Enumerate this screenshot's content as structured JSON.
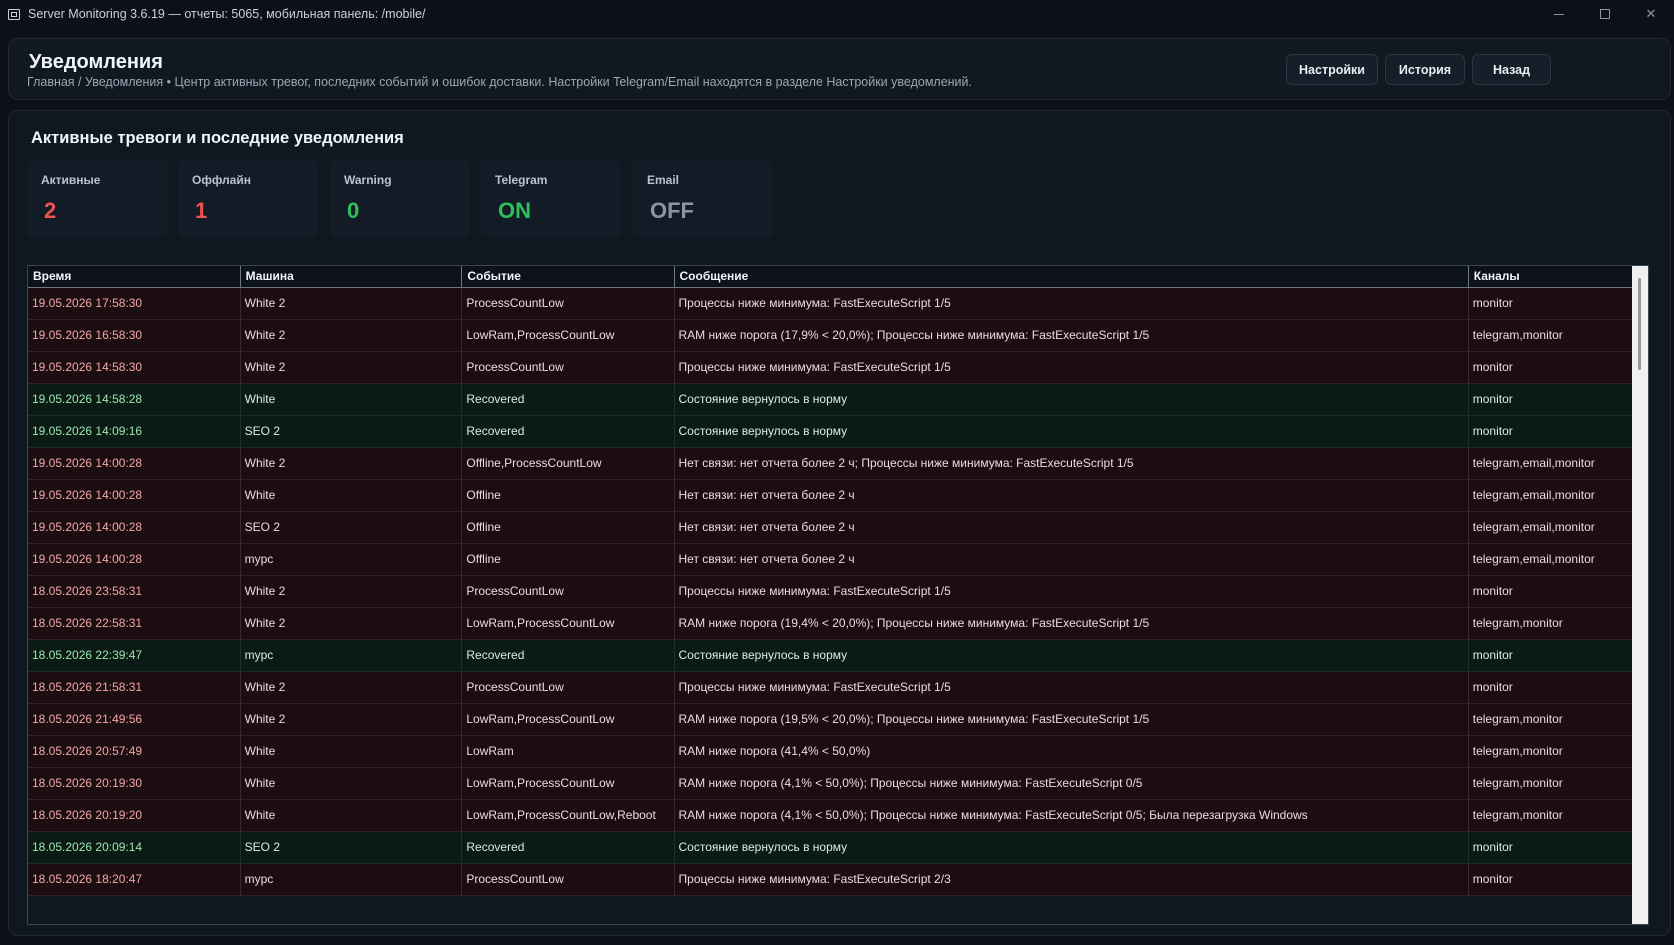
{
  "window": {
    "title": "Server Monitoring 3.6.19 — отчеты: 5065, мобильная панель: /mobile/",
    "controls": {
      "close": "✕"
    }
  },
  "header": {
    "title": "Уведомления",
    "breadcrumb": "Главная / Уведомления  •  Центр активных тревог, последних событий и ошибок доставки. Настройки Telegram/Email находятся в разделе Настройки уведомлений.",
    "buttons": {
      "settings": "Настройки",
      "history": "История",
      "back": "Назад"
    }
  },
  "section": {
    "title": "Активные тревоги и последние уведомления"
  },
  "stats": [
    {
      "label": "Активные",
      "value": "2",
      "color": "#f05252"
    },
    {
      "label": "Оффлайн",
      "value": "1",
      "color": "#f05252"
    },
    {
      "label": "Warning",
      "value": "0",
      "color": "#2fbf5a"
    },
    {
      "label": "Telegram",
      "value": "ON",
      "color": "#2fbf5a"
    },
    {
      "label": "Email",
      "value": "OFF",
      "color": "#8b96a3"
    }
  ],
  "table": {
    "columns": [
      "Время",
      "Машина",
      "Событие",
      "Сообщение",
      "Каналы"
    ],
    "rows": [
      {
        "kind": "alert",
        "cells": [
          "19.05.2026 17:58:30",
          "White 2",
          "ProcessCountLow",
          "Процессы ниже минимума: FastExecuteScript 1/5",
          "monitor"
        ]
      },
      {
        "kind": "alert",
        "cells": [
          "19.05.2026 16:58:30",
          "White 2",
          "LowRam,ProcessCountLow",
          "RAM ниже порога (17,9% < 20,0%); Процессы ниже минимума: FastExecuteScript 1/5",
          "telegram,monitor"
        ]
      },
      {
        "kind": "alert",
        "cells": [
          "19.05.2026 14:58:30",
          "White 2",
          "ProcessCountLow",
          "Процессы ниже минимума: FastExecuteScript 1/5",
          "monitor"
        ]
      },
      {
        "kind": "ok",
        "cells": [
          "19.05.2026 14:58:28",
          "White",
          "Recovered",
          "Состояние вернулось в норму",
          "monitor"
        ]
      },
      {
        "kind": "ok",
        "cells": [
          "19.05.2026 14:09:16",
          "SEO 2",
          "Recovered",
          "Состояние вернулось в норму",
          "monitor"
        ]
      },
      {
        "kind": "alert",
        "cells": [
          "19.05.2026 14:00:28",
          "White 2",
          "Offline,ProcessCountLow",
          "Нет связи: нет отчета более 2 ч; Процессы ниже минимума: FastExecuteScript 1/5",
          "telegram,email,monitor"
        ]
      },
      {
        "kind": "alert",
        "cells": [
          "19.05.2026 14:00:28",
          "White",
          "Offline",
          "Нет связи: нет отчета более 2 ч",
          "telegram,email,monitor"
        ]
      },
      {
        "kind": "alert",
        "cells": [
          "19.05.2026 14:00:28",
          "SEO 2",
          "Offline",
          "Нет связи: нет отчета более 2 ч",
          "telegram,email,monitor"
        ]
      },
      {
        "kind": "alert",
        "cells": [
          "19.05.2026 14:00:28",
          "mypc",
          "Offline",
          "Нет связи: нет отчета более 2 ч",
          "telegram,email,monitor"
        ]
      },
      {
        "kind": "alert",
        "cells": [
          "18.05.2026 23:58:31",
          "White 2",
          "ProcessCountLow",
          "Процессы ниже минимума: FastExecuteScript 1/5",
          "monitor"
        ]
      },
      {
        "kind": "alert",
        "cells": [
          "18.05.2026 22:58:31",
          "White 2",
          "LowRam,ProcessCountLow",
          "RAM ниже порога (19,4% < 20,0%); Процессы ниже минимума: FastExecuteScript 1/5",
          "telegram,monitor"
        ]
      },
      {
        "kind": "ok",
        "cells": [
          "18.05.2026 22:39:47",
          "mypc",
          "Recovered",
          "Состояние вернулось в норму",
          "monitor"
        ]
      },
      {
        "kind": "alert",
        "cells": [
          "18.05.2026 21:58:31",
          "White 2",
          "ProcessCountLow",
          "Процессы ниже минимума: FastExecuteScript 1/5",
          "monitor"
        ]
      },
      {
        "kind": "alert",
        "cells": [
          "18.05.2026 21:49:56",
          "White 2",
          "LowRam,ProcessCountLow",
          "RAM ниже порога (19,5% < 20,0%); Процессы ниже минимума: FastExecuteScript 1/5",
          "telegram,monitor"
        ]
      },
      {
        "kind": "alert",
        "cells": [
          "18.05.2026 20:57:49",
          "White",
          "LowRam",
          "RAM ниже порога (41,4% < 50,0%)",
          "telegram,monitor"
        ]
      },
      {
        "kind": "alert",
        "cells": [
          "18.05.2026 20:19:30",
          "White",
          "LowRam,ProcessCountLow",
          "RAM ниже порога (4,1% < 50,0%); Процессы ниже минимума: FastExecuteScript 0/5",
          "telegram,monitor"
        ]
      },
      {
        "kind": "alert",
        "cells": [
          "18.05.2026 20:19:20",
          "White",
          "LowRam,ProcessCountLow,Reboot",
          "RAM ниже порога (4,1% < 50,0%); Процессы ниже минимума: FastExecuteScript 0/5; Была перезагрузка Windows",
          "telegram,monitor"
        ]
      },
      {
        "kind": "ok",
        "cells": [
          "18.05.2026 20:09:14",
          "SEO 2",
          "Recovered",
          "Состояние вернулось в норму",
          "monitor"
        ]
      },
      {
        "kind": "alert",
        "cells": [
          "18.05.2026 18:20:47",
          "mypc",
          "ProcessCountLow",
          "Процессы ниже минимума: FastExecuteScript 2/3",
          "monitor"
        ]
      }
    ]
  }
}
